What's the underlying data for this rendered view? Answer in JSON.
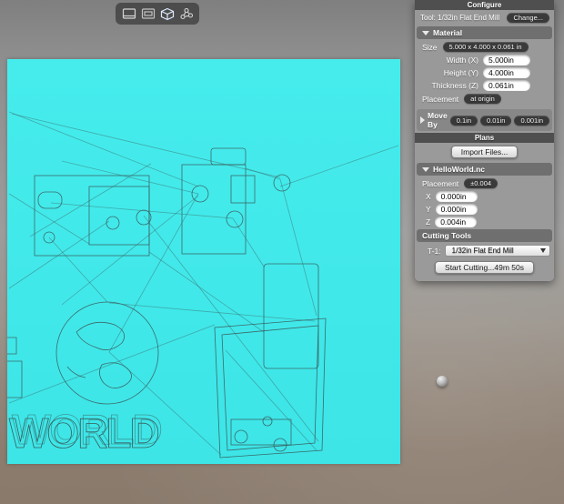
{
  "toolbar": {
    "icons": [
      {
        "name": "flat-view-icon"
      },
      {
        "name": "side-view-icon"
      },
      {
        "name": "solid-3d-view-icon"
      },
      {
        "name": "nodes-view-icon"
      }
    ]
  },
  "canvas": {
    "design_text": "WORLD",
    "material_color": "#3FE9E9",
    "wireframe_color": "#3A5D5D"
  },
  "configure": {
    "title": "Configure",
    "tool_label": "Tool: 1/32in Flat End Mill",
    "change_button": "Change...",
    "material": {
      "header": "Material",
      "size_label": "Size",
      "size_value": "5.000 x 4.000 x 0.061 in",
      "fields": [
        {
          "label": "Width (X)",
          "value": "5.000in"
        },
        {
          "label": "Height (Y)",
          "value": "4.000in"
        },
        {
          "label": "Thickness (Z)",
          "value": "0.061in"
        }
      ],
      "placement_label": "Placement",
      "placement_value": "at origin"
    },
    "move_by": {
      "label": "Move By",
      "steps": [
        "0.1in",
        "0.01in",
        "0.001in"
      ]
    },
    "plans": {
      "header": "Plans",
      "import_button": "Import Files..."
    },
    "plan_file": {
      "header": "HelloWorld.nc",
      "placement_label": "Placement",
      "placement_value": "±0.004",
      "fields": [
        {
          "label": "X",
          "value": "0.000in"
        },
        {
          "label": "Y",
          "value": "0.000in"
        },
        {
          "label": "Z",
          "value": "0.004in"
        }
      ]
    },
    "cutting_tools": {
      "header": "Cutting Tools",
      "slot_label": "T-1:",
      "tool_value": "1/32in Flat End Mill",
      "start_button": "Start Cutting...49m 50s"
    }
  }
}
